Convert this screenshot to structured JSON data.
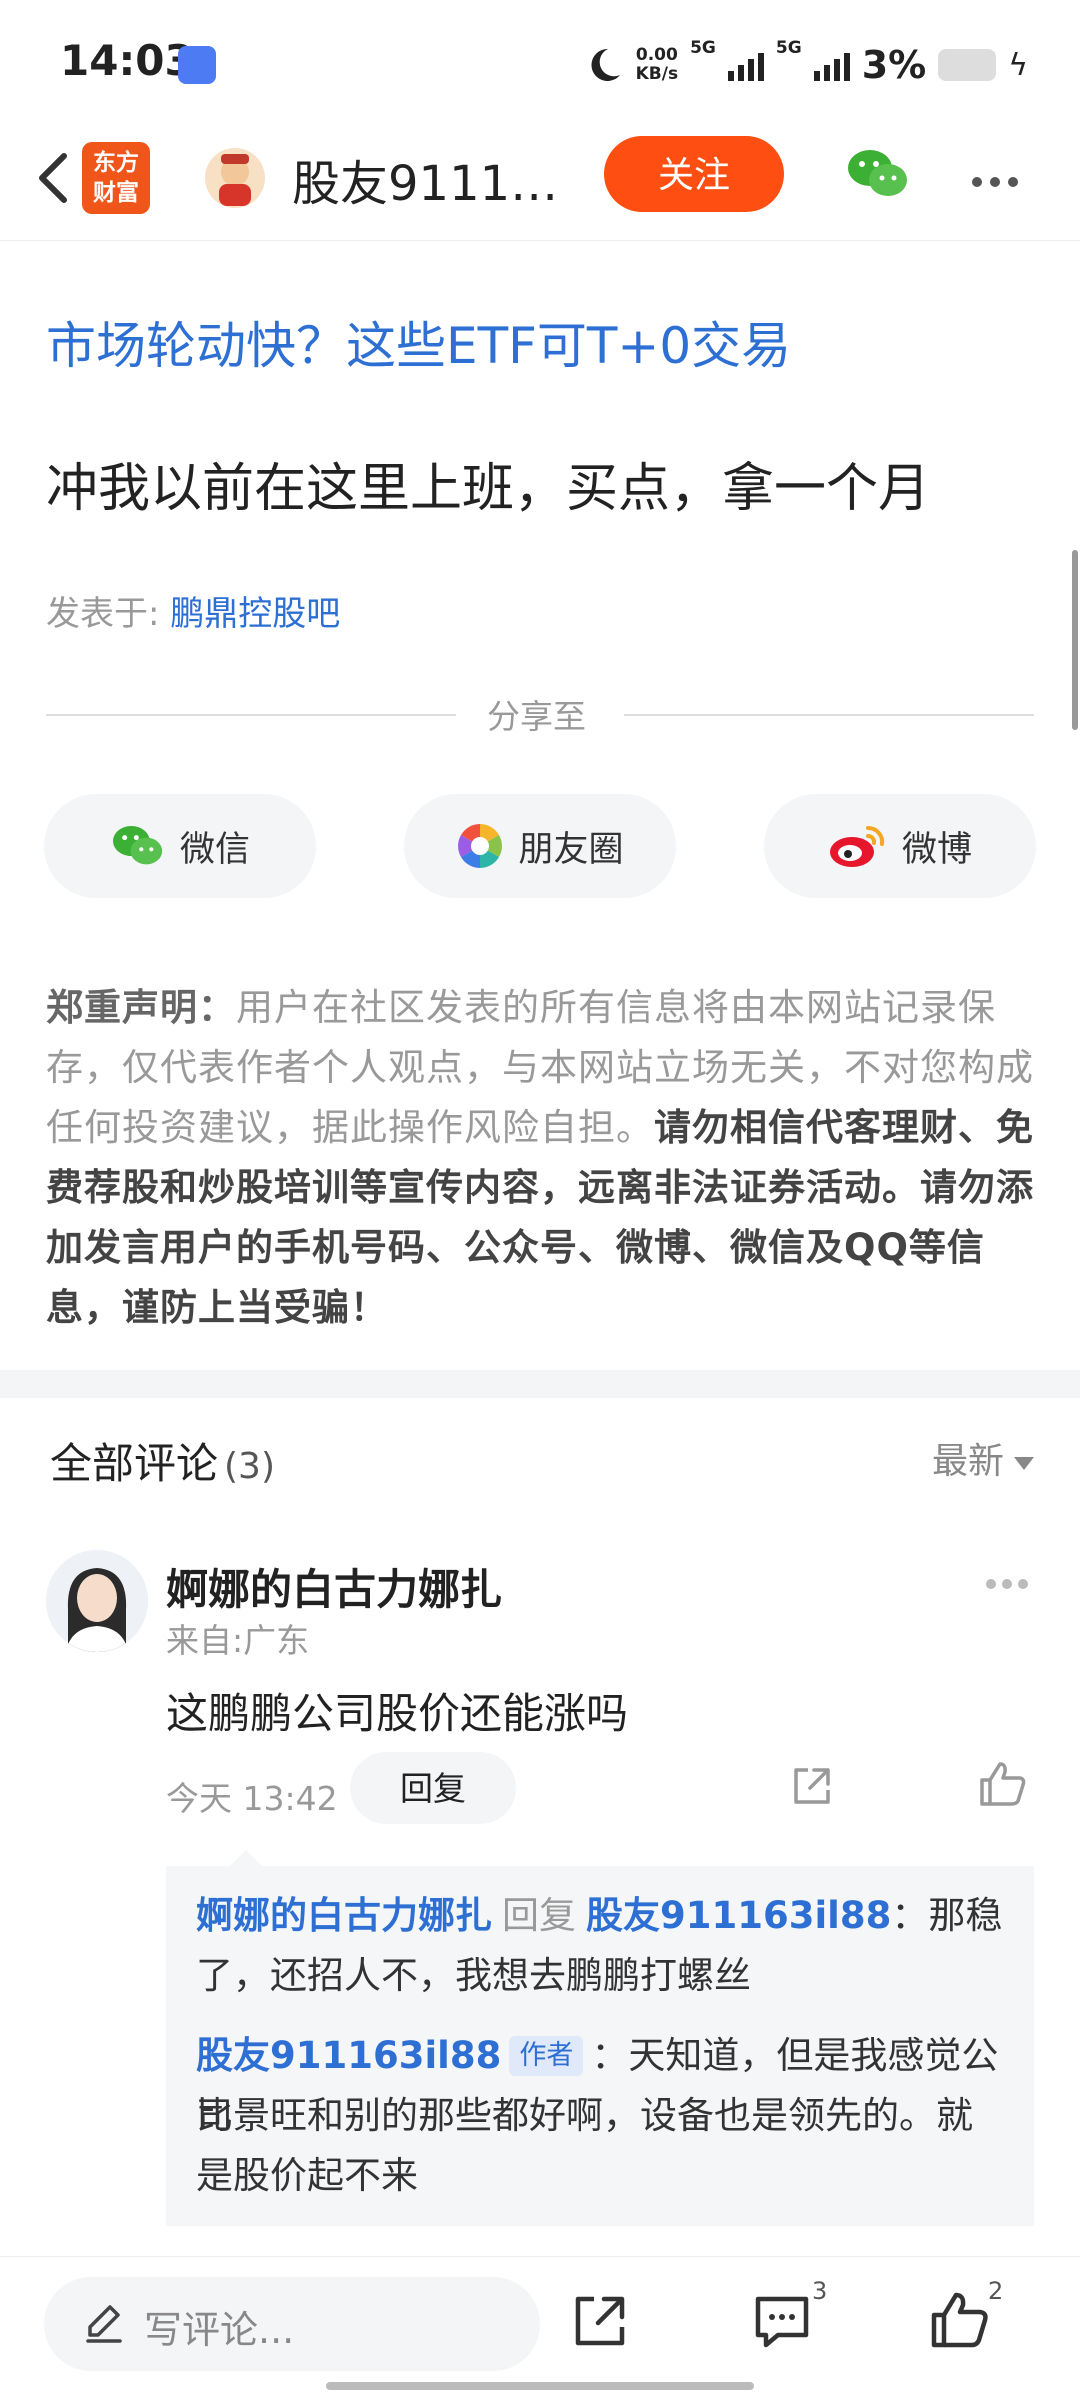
{
  "status_bar": {
    "time": "14:03",
    "net_speed_value": "0.00",
    "net_speed_unit": "KB/s",
    "signal_1": "5G",
    "signal_2": "5G",
    "battery": "3%"
  },
  "nav": {
    "logo_line1": "东方",
    "logo_line2": "财富",
    "title": "股友91116…",
    "follow_label": "关注"
  },
  "post": {
    "ad_link": "市场轮动快？这些ETF可T+0交易",
    "text": "冲我以前在这里上班，买点，拿一个月",
    "posted_in_label": "发表于: ",
    "posted_in_bar": "鹏鼎控股吧"
  },
  "share": {
    "label": "分享至",
    "buttons": [
      "微信",
      "朋友圈",
      "微博"
    ]
  },
  "disclaimer": {
    "title": "郑重声明：",
    "normal": "用户在社区发表的所有信息将由本网站记录保存，仅代表作者个人观点，与本网站立场无关，不对您构成任何投资建议，据此操作风险自担。",
    "bold": "请勿相信代客理财、免费荐股和炒股培训等宣传内容，远离非法证券活动。请勿添加发言用户的手机号码、公众号、微博、微信及QQ等信息，谨防上当受骗！"
  },
  "comments": {
    "header": "全部评论",
    "count": "(3)",
    "sort_label": "最新",
    "items": [
      {
        "name": "婀娜的白古力娜扎",
        "location": "来自:广东",
        "text": "这鹏鹏公司股价还能涨吗",
        "time": "今天 13:42",
        "reply_label": "回复",
        "replies": [
          {
            "user": "婀娜的白古力娜扎",
            "reply_word": "回复",
            "target": "股友911163il88",
            "text_line1": "：那稳",
            "text_line2": "了，还招人不，我想去鹏鹏打螺丝"
          },
          {
            "user": "股友911163il88",
            "tag": "作者",
            "text_line1": "：天知道，但是我感觉公司",
            "text_line2": "比景旺和别的那些都好啊，设备也是领先的。就",
            "text_line3": "是股价起不来"
          }
        ]
      }
    ]
  },
  "bottom_bar": {
    "write_placeholder": "写评论...",
    "comment_count": "3",
    "like_count": "2"
  },
  "colors": {
    "accent_orange": "#ff4e12",
    "link_blue": "#2d6fd3"
  },
  "icons": [
    "back-arrow-icon",
    "wechat-icon",
    "more-icon",
    "moments-icon",
    "weibo-icon",
    "share-icon",
    "like-icon",
    "comment-icon",
    "pencil-icon"
  ]
}
